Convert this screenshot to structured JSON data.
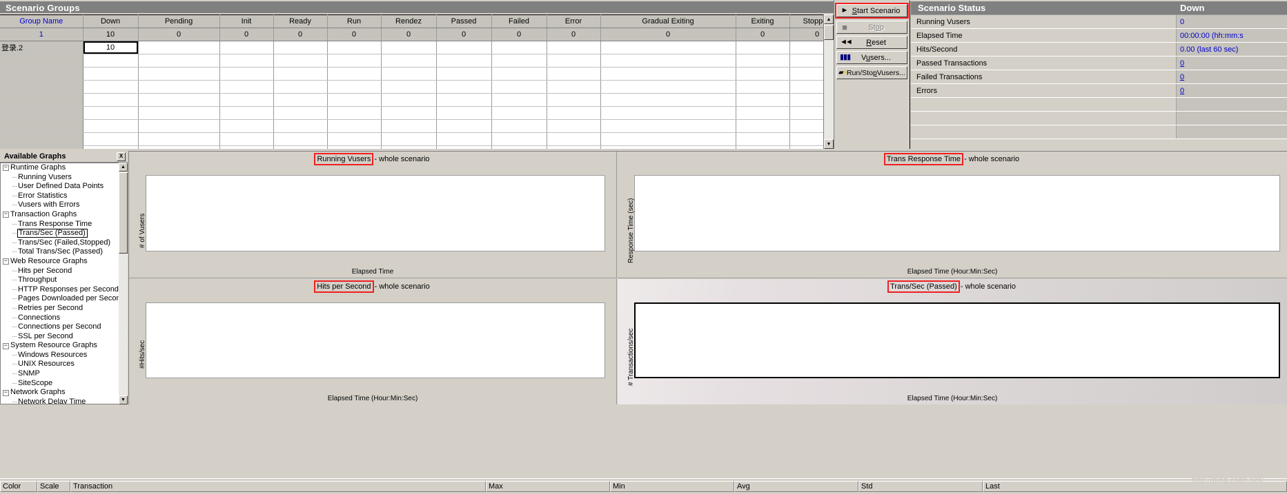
{
  "scenario_groups": {
    "title": "Scenario Groups",
    "columns": [
      "Group Name",
      "Down",
      "Pending",
      "Init",
      "Ready",
      "Run",
      "Rendez",
      "Passed",
      "Failed",
      "Error",
      "Gradual Exiting",
      "Exiting",
      "Stopped"
    ],
    "totals_row": [
      "1",
      "10",
      "0",
      "0",
      "0",
      "0",
      "0",
      "0",
      "0",
      "0",
      "0",
      "0",
      "0"
    ],
    "rows": [
      {
        "name": "登录.2",
        "down": "10"
      }
    ],
    "empty_row_count": 8
  },
  "controls": {
    "start_label": "Start Scenario",
    "start_accel_before": "S",
    "stop_label": "Stop",
    "reset_label": "Reset",
    "vusers_label": "Vusers...",
    "run_stop_vusers_label": "Run/Stop Vusers...",
    "icons": {
      "start": "play-triangle-icon",
      "stop": "stop-square-icon",
      "reset": "rewind-icon",
      "vusers": "vusers-people-icon",
      "run_stop_vusers": "run-stop-vusers-icon"
    },
    "highlight_color": "#f02020"
  },
  "scenario_status": {
    "title": "Scenario Status",
    "state_column": "Down",
    "rows": [
      {
        "label": "Running Vusers",
        "value": "0",
        "link": false
      },
      {
        "label": "Elapsed Time",
        "value": "00:00:00 (hh:mm:s",
        "link": false
      },
      {
        "label": "Hits/Second",
        "value": "0.00 (last 60 sec)",
        "link": false
      },
      {
        "label": "Passed Transactions",
        "value": "0",
        "link": true
      },
      {
        "label": "Failed Transactions",
        "value": "0",
        "link": true
      },
      {
        "label": "Errors",
        "value": "0",
        "link": true
      },
      {
        "label": "",
        "value": "",
        "link": false
      },
      {
        "label": "",
        "value": "",
        "link": false
      },
      {
        "label": "",
        "value": "",
        "link": false
      }
    ],
    "value_color": "#0000cd"
  },
  "available_graphs": {
    "title": "Available Graphs",
    "close_icon": "close-icon",
    "tree": [
      {
        "label": "Runtime Graphs",
        "type": "group",
        "expanded": true
      },
      {
        "label": "Running Vusers",
        "type": "child"
      },
      {
        "label": "User Defined Data Points",
        "type": "child"
      },
      {
        "label": "Error Statistics",
        "type": "child"
      },
      {
        "label": "Vusers with Errors",
        "type": "child"
      },
      {
        "label": "Transaction Graphs",
        "type": "group",
        "expanded": true
      },
      {
        "label": "Trans Response Time",
        "type": "child"
      },
      {
        "label": "Trans/Sec (Passed)",
        "type": "child",
        "selected": true
      },
      {
        "label": "Trans/Sec (Failed,Stopped)",
        "type": "child"
      },
      {
        "label": "Total Trans/Sec (Passed)",
        "type": "child"
      },
      {
        "label": "Web Resource Graphs",
        "type": "group",
        "expanded": true
      },
      {
        "label": "Hits per Second",
        "type": "child"
      },
      {
        "label": "Throughput",
        "type": "child"
      },
      {
        "label": "HTTP Responses per Second",
        "type": "child"
      },
      {
        "label": "Pages Downloaded per Second",
        "type": "child"
      },
      {
        "label": "Retries per Second",
        "type": "child"
      },
      {
        "label": "Connections",
        "type": "child"
      },
      {
        "label": "Connections per Second",
        "type": "child"
      },
      {
        "label": "SSL per Second",
        "type": "child"
      },
      {
        "label": "System Resource Graphs",
        "type": "group",
        "expanded": true
      },
      {
        "label": "Windows Resources",
        "type": "child"
      },
      {
        "label": "UNIX Resources",
        "type": "child"
      },
      {
        "label": "SNMP",
        "type": "child"
      },
      {
        "label": "SiteScope",
        "type": "child"
      },
      {
        "label": "Network Graphs",
        "type": "group",
        "expanded": true
      },
      {
        "label": "Network Delay Time",
        "type": "child"
      }
    ]
  },
  "graph_panes": [
    {
      "name": "Running Vusers",
      "suffix": "- whole scenario",
      "ylabel": "# of Vusers",
      "xlabel": "Elapsed Time",
      "selected": false
    },
    {
      "name": "Trans Response Time",
      "suffix": "- whole scenario",
      "ylabel": "Response Time (sec)",
      "xlabel": "Elapsed Time (Hour:Min:Sec)",
      "selected": false
    },
    {
      "name": "Hits per Second",
      "suffix": "- whole scenario",
      "ylabel": "#Hits/sec",
      "xlabel": "Elapsed Time (Hour:Min:Sec)",
      "selected": false
    },
    {
      "name": "Trans/Sec (Passed)",
      "suffix": "- whole scenario",
      "ylabel": "# Transactions/sec",
      "xlabel": "Elapsed Time (Hour:Min:Sec)",
      "selected": true
    }
  ],
  "chart_data": [
    {
      "type": "line",
      "title": "Running Vusers - whole scenario",
      "xlabel": "Elapsed Time",
      "ylabel": "# of Vusers",
      "series": [],
      "x": [],
      "grid": false,
      "legend": "none",
      "note": "empty plot - scenario not started"
    },
    {
      "type": "line",
      "title": "Trans Response Time - whole scenario",
      "xlabel": "Elapsed Time (Hour:Min:Sec)",
      "ylabel": "Response Time (sec)",
      "series": [],
      "x": [],
      "grid": false,
      "legend": "none",
      "note": "empty plot - scenario not started"
    },
    {
      "type": "line",
      "title": "Hits per Second - whole scenario",
      "xlabel": "Elapsed Time (Hour:Min:Sec)",
      "ylabel": "#Hits/sec",
      "series": [],
      "x": [],
      "grid": false,
      "legend": "none",
      "note": "empty plot - scenario not started"
    },
    {
      "type": "line",
      "title": "Trans/Sec (Passed) - whole scenario",
      "xlabel": "Elapsed Time (Hour:Min:Sec)",
      "ylabel": "# Transactions/sec",
      "series": [],
      "x": [],
      "grid": false,
      "legend": "none",
      "note": "empty plot - scenario not started"
    }
  ],
  "legend_bar": {
    "columns": [
      "Color",
      "Scale",
      "Transaction",
      "Max",
      "Min",
      "Avg",
      "Std",
      "Last"
    ]
  },
  "watermark": "http://blog.csdn.net/",
  "colors": {
    "window_face": "#d4d0c8",
    "titlebar": "#808080",
    "grid_header": "#c6c3bc",
    "link_blue": "#0000cd",
    "highlight_red": "#f02020"
  }
}
